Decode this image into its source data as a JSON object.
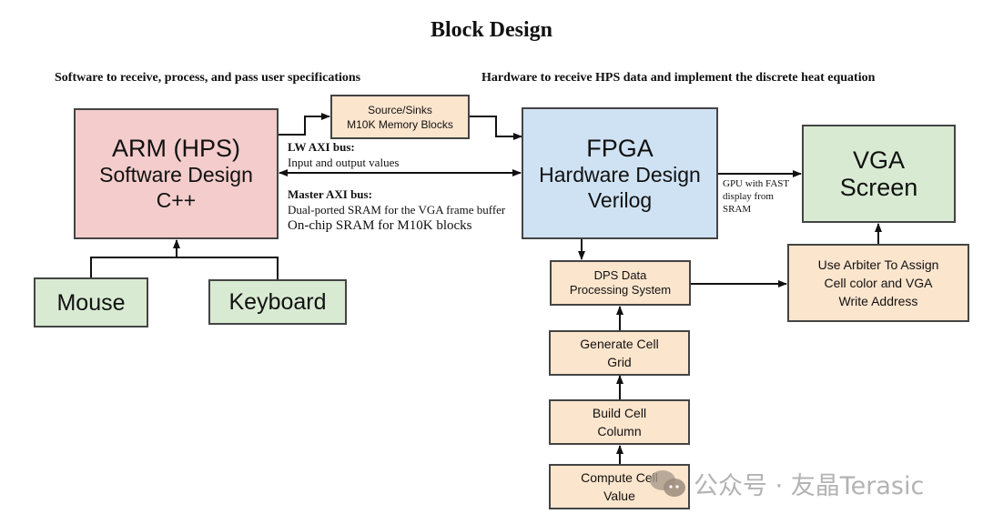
{
  "title": "Block Design",
  "sections": {
    "software": "Software to receive, process, and pass user specifications",
    "hardware": "Hardware to receive HPS data and implement the discrete heat equation"
  },
  "blocks": {
    "arm": {
      "line1": "ARM (HPS)",
      "line2": "Software Design",
      "line3": "C++",
      "color": "#f4cccc"
    },
    "fpga": {
      "line1": "FPGA",
      "line2": "Hardware Design",
      "line3": "Verilog",
      "color": "#cfe2f3"
    },
    "vga": {
      "line1": "VGA",
      "line2": "Screen",
      "color": "#d9ead3"
    },
    "source_sinks": {
      "line1": "Source/Sinks",
      "line2": "M10K Memory Blocks",
      "color": "#fce5cd"
    },
    "mouse": {
      "label": "Mouse",
      "color": "#d9ead3"
    },
    "keyboard": {
      "label": "Keyboard",
      "color": "#d9ead3"
    },
    "dps": {
      "line1": "DPS Data",
      "line2": "Processing System",
      "color": "#fce5cd"
    },
    "arbiter": {
      "line1": "Use Arbiter To Assign",
      "line2": "Cell color and VGA",
      "line3": "Write Address",
      "color": "#fce5cd"
    },
    "generate_grid": {
      "line1": "Generate Cell",
      "line2": "Grid",
      "color": "#fce5cd"
    },
    "build_column": {
      "line1": "Build Cell",
      "line2": "Column",
      "color": "#fce5cd"
    },
    "compute_value": {
      "line1": "Compute Cell",
      "line2": "Value",
      "color": "#fce5cd"
    }
  },
  "annotations": {
    "lw_axi_title": "LW AXI bus:",
    "lw_axi_desc": "Input and output values",
    "master_axi_title": "Master AXI bus:",
    "master_axi_desc1": "Dual-ported SRAM for the VGA frame buffer",
    "master_axi_desc2": "On-chip SRAM for M10K blocks",
    "gpu_line1": "GPU with FAST",
    "gpu_line2": "display from",
    "gpu_line3": "SRAM"
  },
  "watermark": {
    "text": "公众号 · 友晶Terasic",
    "icon": "wechat-icon"
  }
}
